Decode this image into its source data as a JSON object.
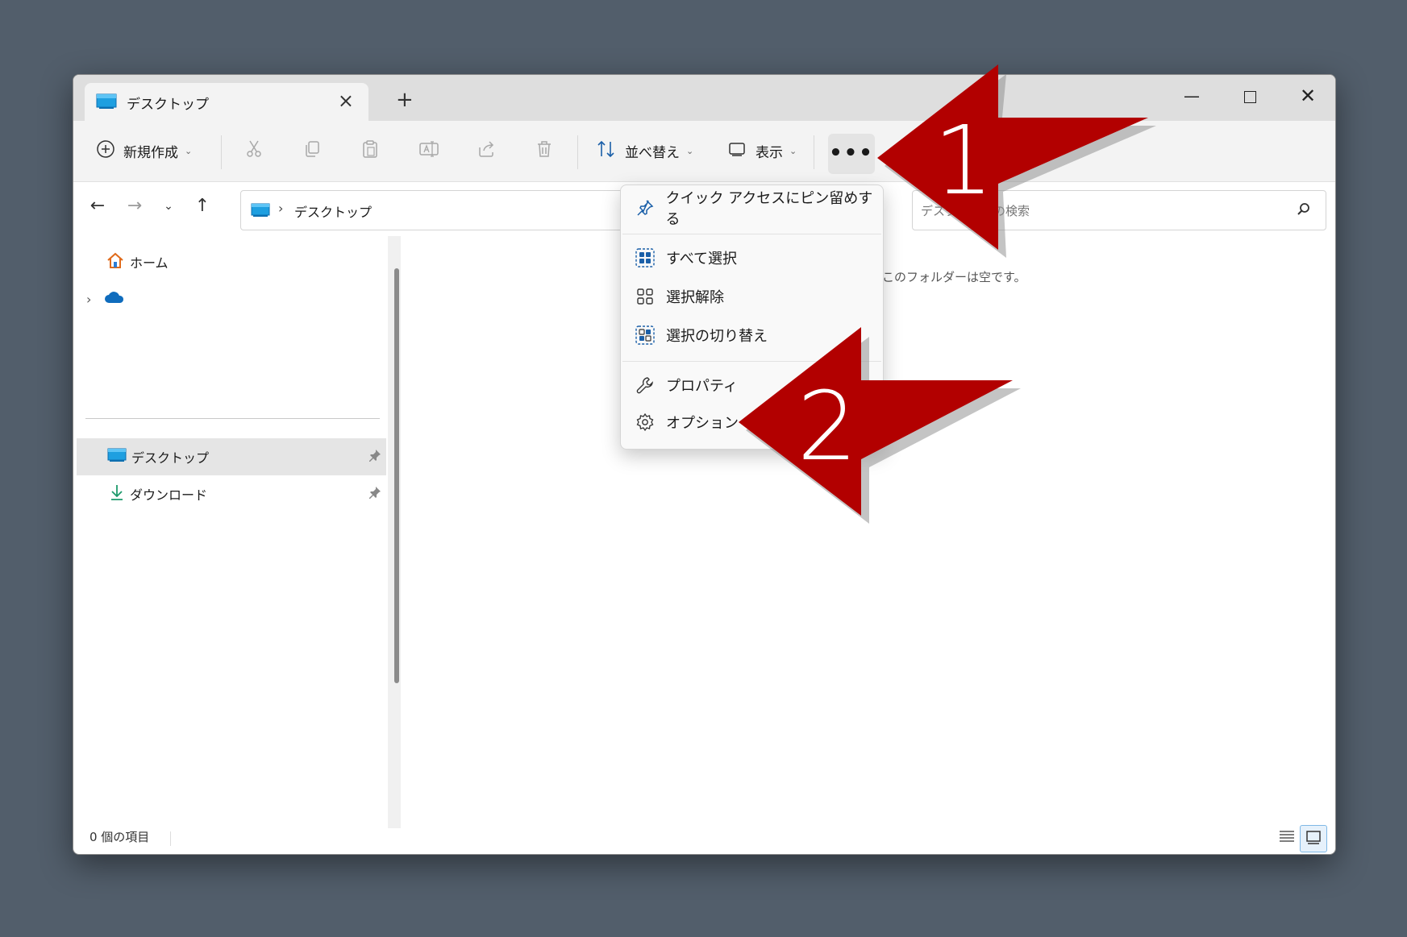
{
  "window": {
    "tab_title": "デスクトップ",
    "new_tab": "+"
  },
  "toolbar": {
    "new_label": "新規作成",
    "sort_label": "並べ替え",
    "view_label": "表示",
    "more_label": "•••"
  },
  "address": {
    "path": "デスクトップ",
    "separator": "›"
  },
  "search": {
    "placeholder": "デスクトップの検索"
  },
  "sidebar": {
    "items": [
      {
        "label": "ホーム"
      },
      {
        "label": ""
      },
      {
        "label": "デスクトップ"
      },
      {
        "label": "ダウンロード"
      }
    ]
  },
  "content": {
    "empty_message": "このフォルダーは空です。"
  },
  "status": {
    "count_text": "0 個の項目"
  },
  "menu": {
    "items": [
      {
        "label": "クイック アクセスにピン留めする",
        "icon": "pin-icon"
      },
      {
        "label": "すべて選択",
        "icon": "select-all-icon"
      },
      {
        "label": "選択解除",
        "icon": "select-none-icon"
      },
      {
        "label": "選択の切り替え",
        "icon": "invert-selection-icon"
      },
      {
        "label": "プロパティ",
        "icon": "wrench-icon"
      },
      {
        "label": "オプション",
        "icon": "gear-icon"
      }
    ]
  },
  "annotations": {
    "step1": "1",
    "step2": "2",
    "arrow_color": "#b20000"
  }
}
